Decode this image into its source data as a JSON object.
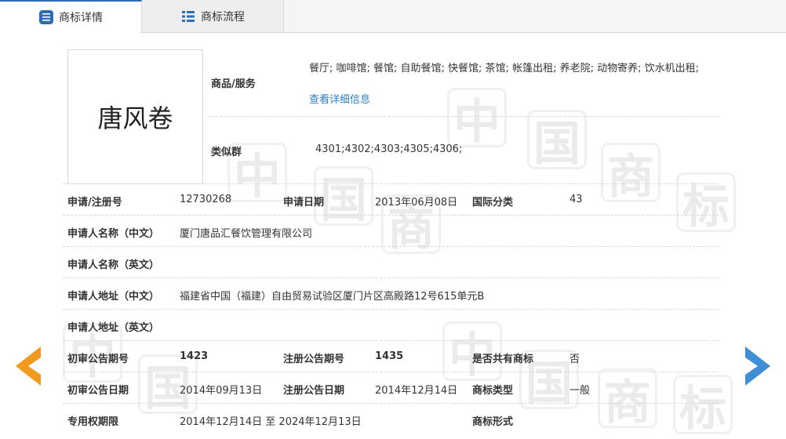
{
  "tabs": {
    "details": "商标详情",
    "flow": "商标流程"
  },
  "trademark": {
    "image_text": "唐风卷",
    "goods_label": "商品/服务",
    "goods_value": "餐厅; 咖啡馆; 餐馆; 自助餐馆; 快餐馆; 茶馆; 帐篷出租; 养老院; 动物寄养; 饮水机出租;",
    "detail_link": "查看详细信息",
    "similar_label": "类似群",
    "similar_value": "4301;4302;4303;4305;4306;"
  },
  "rows": {
    "reg_no_label": "申请/注册号",
    "reg_no": "12730268",
    "apply_date_label": "申请日期",
    "apply_date": "2013年06月08日",
    "intl_class_label": "国际分类",
    "intl_class": "43",
    "applicant_cn_label": "申请人名称（中文）",
    "applicant_cn": "厦门唐品汇餐饮管理有限公司",
    "applicant_en_label": "申请人名称（英文）",
    "addr_cn_label": "申请人地址（中文）",
    "addr_cn": "福建省中国（福建）自由贸易试验区厦门片区高殿路12号615单元B",
    "addr_en_label": "申请人地址（英文）",
    "prelim_no_label": "初审公告期号",
    "prelim_no": "1423",
    "reg_pub_no_label": "注册公告期号",
    "reg_pub_no": "1435",
    "shared_label": "是否共有商标",
    "shared": "否",
    "prelim_date_label": "初审公告日期",
    "prelim_date": "2014年09月13日",
    "reg_pub_date_label": "注册公告日期",
    "reg_pub_date": "2014年12月14日",
    "type_label": "商标类型",
    "type": "一般",
    "term_label": "专用权期限",
    "term": "2014年12月14日 至 2024年12月13日",
    "form_label": "商标形式"
  },
  "watermark": [
    "中",
    "国",
    "商",
    "标"
  ],
  "colors": {
    "accent_blue": "#2e6db4",
    "link": "#2f7fc4",
    "prev_arrow": "#f39a1e",
    "next_arrow": "#3e8fd6"
  },
  "icons": {
    "tab_details": "document-list-icon",
    "tab_flow": "list-icon",
    "prev": "chevron-left-icon",
    "next": "chevron-right-icon"
  }
}
